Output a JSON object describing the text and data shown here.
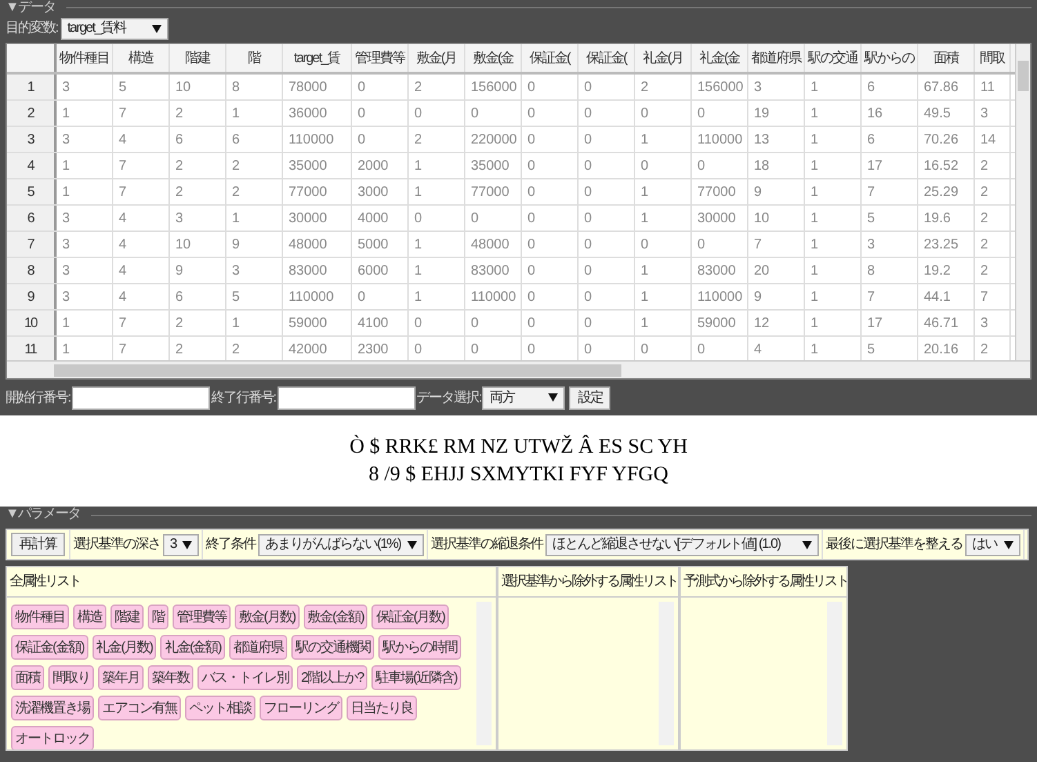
{
  "data_section": {
    "title": "▼データ",
    "target_label": "目的変数:",
    "target_value": "target_賃料",
    "table": {
      "columns": [
        "物件種目",
        "構造",
        "階建",
        "階",
        "target_賃",
        "管理費等",
        "敷金(月",
        "敷金(金",
        "保証金(",
        "保証金(",
        "礼金(月",
        "礼金(金",
        "都道府県",
        "駅の交通",
        "駅からの",
        "面積",
        "間取"
      ],
      "rows": [
        {
          "index": "1",
          "cells": [
            "3",
            "5",
            "10",
            "8",
            "78000",
            "0",
            "2",
            "156000",
            "0",
            "0",
            "2",
            "156000",
            "3",
            "1",
            "6",
            "67.86",
            "11"
          ]
        },
        {
          "index": "2",
          "cells": [
            "1",
            "7",
            "2",
            "1",
            "36000",
            "0",
            "0",
            "0",
            "0",
            "0",
            "0",
            "0",
            "19",
            "1",
            "16",
            "49.5",
            "3"
          ]
        },
        {
          "index": "3",
          "cells": [
            "3",
            "4",
            "6",
            "6",
            "110000",
            "0",
            "2",
            "220000",
            "0",
            "0",
            "1",
            "110000",
            "13",
            "1",
            "6",
            "70.26",
            "14"
          ]
        },
        {
          "index": "4",
          "cells": [
            "1",
            "7",
            "2",
            "2",
            "35000",
            "2000",
            "1",
            "35000",
            "0",
            "0",
            "0",
            "0",
            "18",
            "1",
            "17",
            "16.52",
            "2"
          ]
        },
        {
          "index": "5",
          "cells": [
            "1",
            "7",
            "2",
            "2",
            "77000",
            "3000",
            "1",
            "77000",
            "0",
            "0",
            "1",
            "77000",
            "9",
            "1",
            "7",
            "25.29",
            "2"
          ]
        },
        {
          "index": "6",
          "cells": [
            "3",
            "4",
            "3",
            "1",
            "30000",
            "4000",
            "0",
            "0",
            "0",
            "0",
            "1",
            "30000",
            "10",
            "1",
            "5",
            "19.6",
            "2"
          ]
        },
        {
          "index": "7",
          "cells": [
            "3",
            "4",
            "10",
            "9",
            "48000",
            "5000",
            "1",
            "48000",
            "0",
            "0",
            "0",
            "0",
            "7",
            "1",
            "3",
            "23.25",
            "2"
          ]
        },
        {
          "index": "8",
          "cells": [
            "3",
            "4",
            "9",
            "3",
            "83000",
            "6000",
            "1",
            "83000",
            "0",
            "0",
            "1",
            "83000",
            "20",
            "1",
            "8",
            "19.2",
            "2"
          ]
        },
        {
          "index": "9",
          "cells": [
            "3",
            "4",
            "6",
            "5",
            "110000",
            "0",
            "1",
            "110000",
            "0",
            "0",
            "1",
            "110000",
            "9",
            "1",
            "7",
            "44.1",
            "7"
          ]
        },
        {
          "index": "10",
          "cells": [
            "1",
            "7",
            "2",
            "1",
            "59000",
            "4100",
            "0",
            "0",
            "0",
            "0",
            "1",
            "59000",
            "12",
            "1",
            "17",
            "46.71",
            "3"
          ]
        },
        {
          "index": "11",
          "cells": [
            "1",
            "7",
            "2",
            "2",
            "42000",
            "2300",
            "0",
            "0",
            "0",
            "0",
            "0",
            "0",
            "4",
            "1",
            "5",
            "20.16",
            "2"
          ]
        }
      ]
    },
    "start_row_label": "開始行番号:",
    "end_row_label": "終了行番号:",
    "data_select_label": "データ選択:",
    "data_select_value": "両方",
    "set_button": "設定"
  },
  "caption_lines": [
    "Ò $ RRK£ RM NZ UTWŽ Â ES SC YH",
    "8 /9 $ EHJJ SXMYTKI FYF YFGQ"
  ],
  "parameter_section": {
    "title": "▼パラメータ",
    "recalc_button": "再計算",
    "settings": [
      {
        "label": "選択基準の深さ",
        "value": "3"
      },
      {
        "label": "終了条件",
        "value": "あまりがんばらない(1%)"
      },
      {
        "label": "選択基準の縮退条件",
        "value": "ほとんど縮退させない[デフォルト値] (1.0)"
      },
      {
        "label": "最後に選択基準を整える",
        "value": "はい"
      }
    ],
    "lists": [
      {
        "title": "全属性リスト",
        "items": [
          "物件種目",
          "構造",
          "階建",
          "階",
          "管理費等",
          "敷金(月数)",
          "敷金(金額)",
          "保証金(月数)",
          "保証金(金額)",
          "礼金(月数)",
          "礼金(金額)",
          "都道府県",
          "駅の交通機関",
          "駅からの時間",
          "面積",
          "間取り",
          "築年月",
          "築年数",
          "バス・トイレ別",
          "2階以上か?",
          "駐車場(近隣含)",
          "洗濯機置き場",
          "エアコン有無",
          "ペット相談",
          "フローリング",
          "日当たり良",
          "オートロック"
        ]
      },
      {
        "title": "選択基準から除外する属性リスト"
      },
      {
        "title": "予測式から除外する属性リスト"
      }
    ]
  }
}
